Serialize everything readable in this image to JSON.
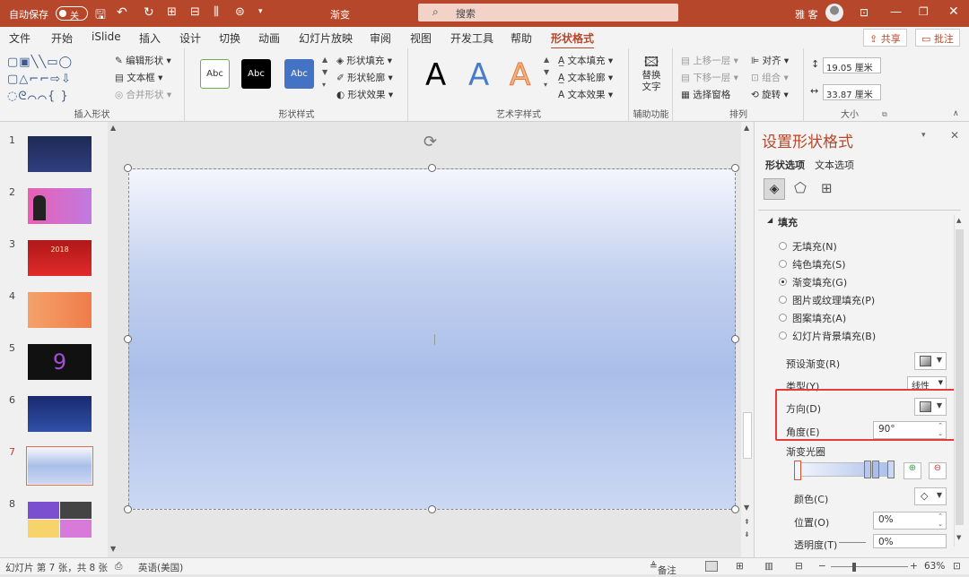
{
  "titlebar": {
    "autosave_label": "自动保存",
    "autosave_state": "关",
    "doc_title": "渐变",
    "search_placeholder": "搜索",
    "user_name": "雅 客"
  },
  "tabs": [
    "文件",
    "开始",
    "iSlide",
    "插入",
    "设计",
    "切换",
    "动画",
    "幻灯片放映",
    "审阅",
    "视图",
    "开发工具",
    "帮助",
    "形状格式"
  ],
  "active_tab": "形状格式",
  "top_actions": {
    "share": "共享",
    "comment": "批注"
  },
  "ribbon": {
    "insert_shapes": {
      "edit_shape": "编辑形状",
      "text_box": "文本框",
      "merge_shapes": "合并形状",
      "label": "插入形状"
    },
    "shape_styles": {
      "samples": [
        "Abc",
        "Abc",
        "Abc"
      ],
      "fill": "形状填充",
      "outline": "形状轮廓",
      "effects": "形状效果",
      "label": "形状样式"
    },
    "wordart": {
      "samples": [
        "A",
        "A",
        "A"
      ],
      "text_fill": "文本填充",
      "text_outline": "文本轮廓",
      "text_effects": "文本效果",
      "label": "艺术字样式"
    },
    "accessibility": {
      "alt_text_1": "替换",
      "alt_text_2": "文字",
      "label": "辅助功能"
    },
    "arrange": {
      "bring_forward": "上移一层",
      "send_backward": "下移一层",
      "selection_pane": "选择窗格",
      "align": "对齐",
      "group": "组合",
      "rotate": "旋转",
      "label": "排列"
    },
    "size": {
      "height": "19.05 厘米",
      "width": "33.87 厘米",
      "label": "大小"
    }
  },
  "slides": [
    {
      "num": "1",
      "title": ""
    },
    {
      "num": "2",
      "title": ""
    },
    {
      "num": "3",
      "title": "2018"
    },
    {
      "num": "4",
      "title": ""
    },
    {
      "num": "5",
      "title": "9"
    },
    {
      "num": "6",
      "title": ""
    },
    {
      "num": "7",
      "title": ""
    },
    {
      "num": "8",
      "title": ""
    }
  ],
  "selected_slide": 7,
  "format_pane": {
    "title": "设置形状格式",
    "tab_shape": "形状选项",
    "tab_text": "文本选项",
    "section": "填充",
    "fill_options": [
      {
        "label": "无填充(N)",
        "selected": false
      },
      {
        "label": "纯色填充(S)",
        "selected": false
      },
      {
        "label": "渐变填充(G)",
        "selected": true
      },
      {
        "label": "图片或纹理填充(P)",
        "selected": false
      },
      {
        "label": "图案填充(A)",
        "selected": false
      },
      {
        "label": "幻灯片背景填充(B)",
        "selected": false
      }
    ],
    "preset_label": "预设渐变(R)",
    "type_label": "类型(Y)",
    "type_value": "线性",
    "direction_label": "方向(D)",
    "angle_label": "角度(E)",
    "angle_value": "90°",
    "stops_label": "渐变光圈",
    "color_label": "颜色(C)",
    "position_label": "位置(O)",
    "position_value": "0%",
    "transparency_label": "透明度(T)",
    "transparency_value": "0%"
  },
  "status": {
    "slide_info": "幻灯片 第 7 张，共 8 张",
    "language": "英语(美国)",
    "notes": "备注",
    "zoom": "63%"
  }
}
